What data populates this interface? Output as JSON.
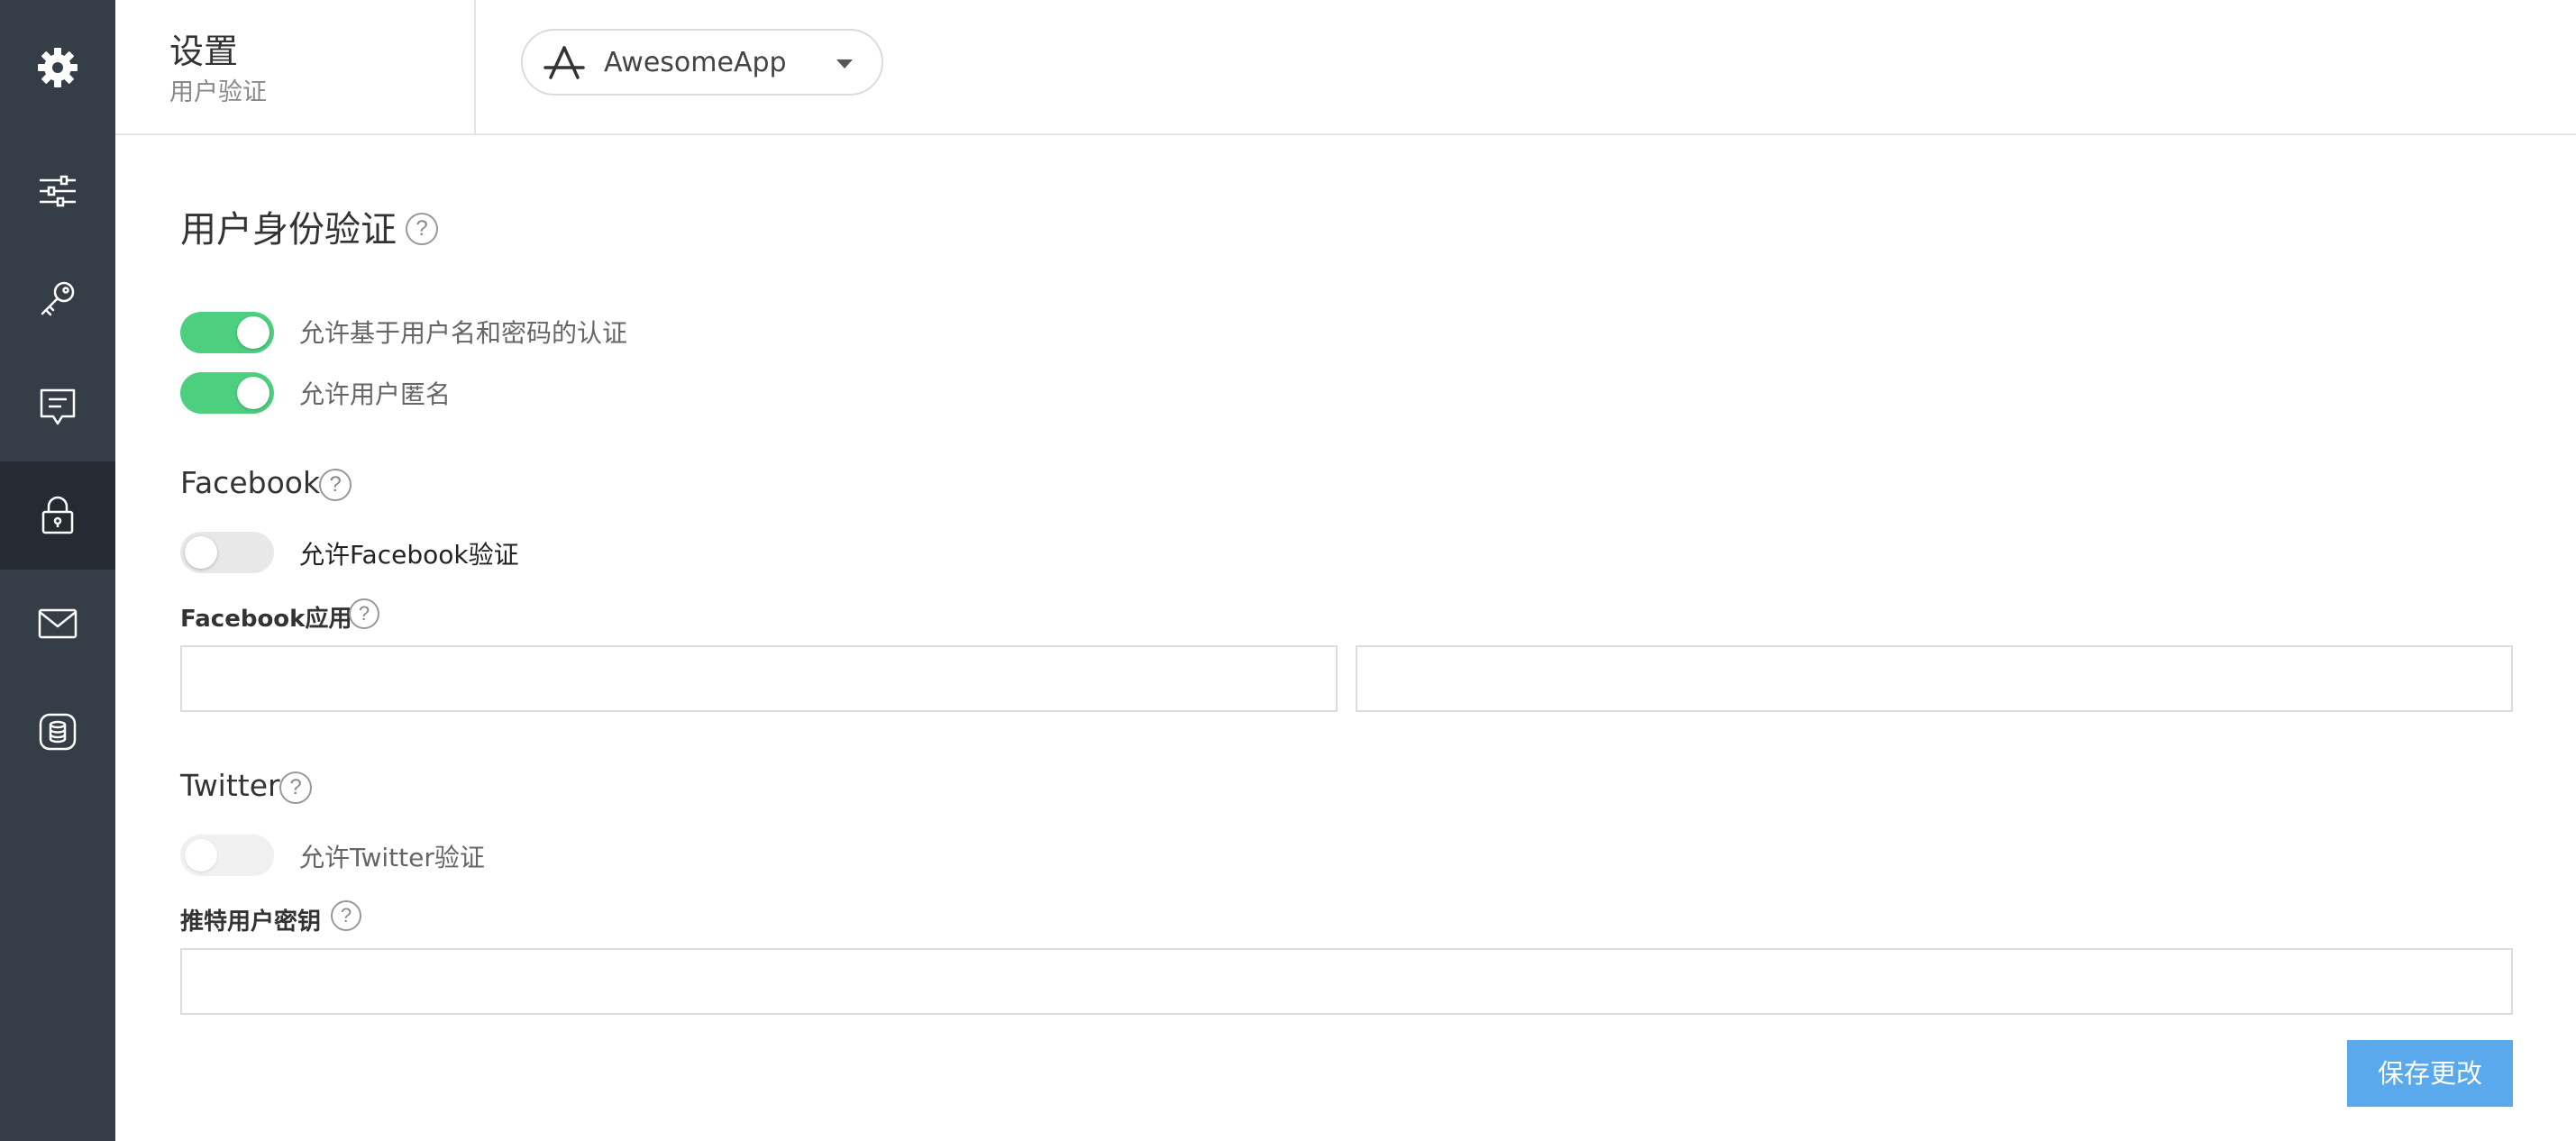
{
  "sidebar": {
    "items": [
      {
        "icon": "gear-icon"
      },
      {
        "icon": "sliders-icon"
      },
      {
        "icon": "key-icon"
      },
      {
        "icon": "chat-icon"
      },
      {
        "icon": "lock-icon",
        "active": true
      },
      {
        "icon": "mail-icon"
      },
      {
        "icon": "database-icon"
      }
    ]
  },
  "header": {
    "title": "设置",
    "subtitle": "用户验证",
    "app_select": {
      "value": "AwesomeApp",
      "icon": "app-store-icon"
    }
  },
  "main": {
    "title": "用户身份验证",
    "help_glyph": "?",
    "toggles": [
      {
        "label": "允许基于用户名和密码的认证",
        "state": "on"
      },
      {
        "label": "允许用户匿名",
        "state": "on"
      }
    ],
    "facebook": {
      "heading": "Facebook",
      "toggle_label": "允许Facebook验证",
      "toggle_state": "off",
      "field_label": "Facebook应用",
      "field1_value": "",
      "field2_value": ""
    },
    "twitter": {
      "heading": "Twitter",
      "toggle_label": "允许Twitter验证",
      "toggle_state": "off-disabled",
      "field_label": "推特用户密钥",
      "field_value": ""
    },
    "save_label": "保存更改"
  },
  "colors": {
    "sidebar_bg": "#353d47",
    "sidebar_active": "#252b33",
    "toggle_on": "#4cd080",
    "button": "#5aa9ec"
  }
}
